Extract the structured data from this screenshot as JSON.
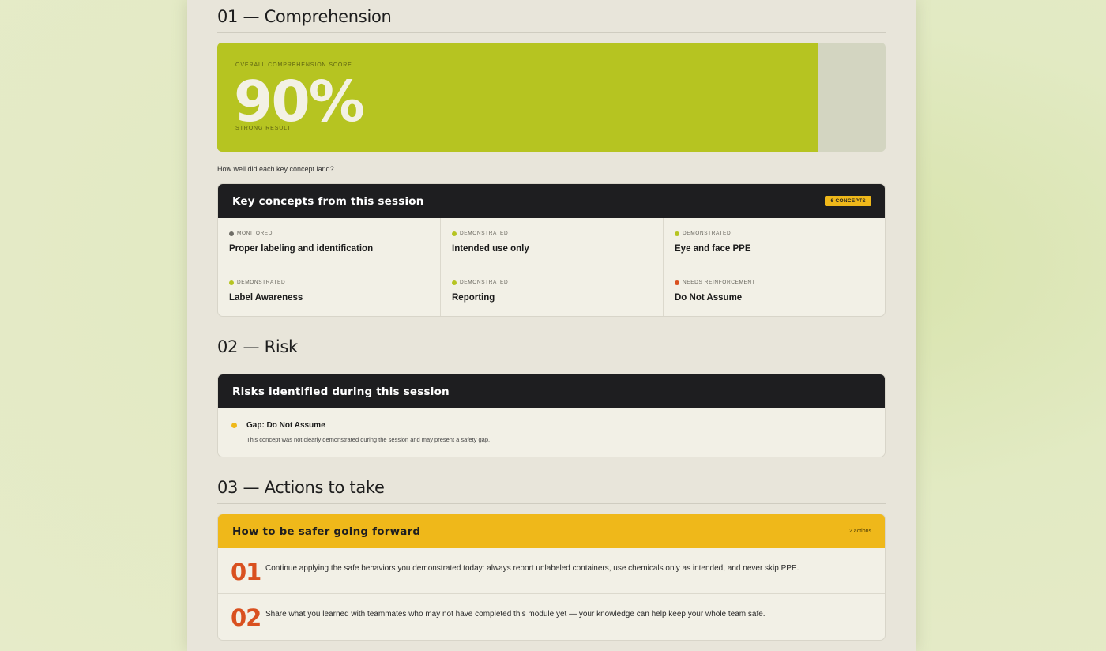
{
  "colors": {
    "accent_lime": "#b6c421",
    "accent_yellow": "#efb81a",
    "accent_orange": "#d9501f",
    "dark": "#1e1e20"
  },
  "sections": {
    "comprehension_title": "01 — Comprehension",
    "risk_title": "02 — Risk",
    "actions_title": "03 — Actions to take"
  },
  "score": {
    "label": "Overall comprehension score",
    "value": "90%",
    "fill_percent": 90,
    "sub": "Strong result"
  },
  "question": "How well did each key concept land?",
  "concepts": {
    "title": "Key concepts from this session",
    "badge": "6 concepts",
    "items": [
      {
        "status": "Monitored",
        "dot": "#6f6d66",
        "name": "Proper labeling and identification"
      },
      {
        "status": "Demonstrated",
        "dot": "#b6c421",
        "name": "Intended use only"
      },
      {
        "status": "Demonstrated",
        "dot": "#b6c421",
        "name": "Eye and face PPE"
      },
      {
        "status": "Demonstrated",
        "dot": "#b6c421",
        "name": "Label Awareness"
      },
      {
        "status": "Demonstrated",
        "dot": "#b6c421",
        "name": "Reporting"
      },
      {
        "status": "Needs reinforcement",
        "dot": "#d9501f",
        "name": "Do Not Assume"
      }
    ]
  },
  "risks": {
    "title": "Risks identified during this session",
    "items": [
      {
        "title": "Gap: Do Not Assume",
        "desc": "This concept was not clearly demonstrated during the session and may present a safety gap."
      }
    ]
  },
  "actions": {
    "title": "How to be safer going forward",
    "count": "2 actions",
    "items": [
      {
        "num": "01",
        "text": "Continue applying the safe behaviors you demonstrated today: always report unlabeled containers, use chemicals only as intended, and never skip PPE."
      },
      {
        "num": "02",
        "text": "Share what you learned with teammates who may not have completed this module yet — your knowledge can help keep your whole team safe."
      }
    ]
  }
}
